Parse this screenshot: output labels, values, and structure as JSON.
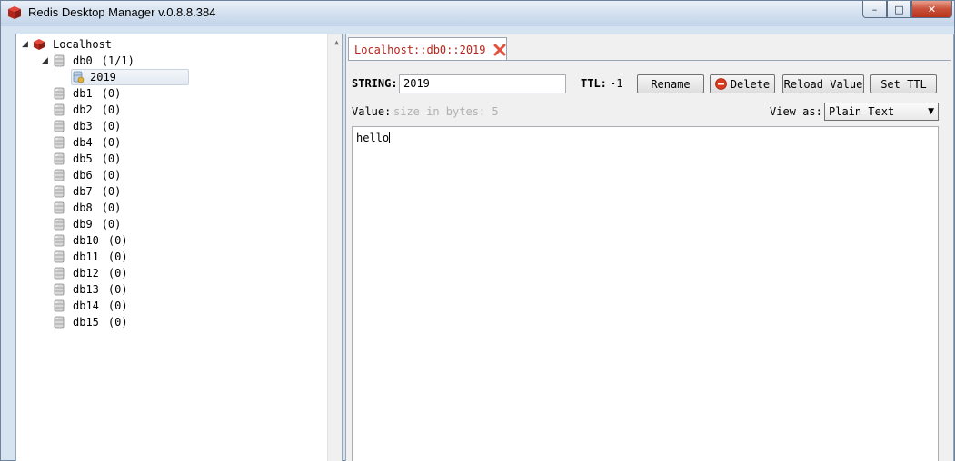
{
  "window": {
    "title": "Redis Desktop Manager v.0.8.8.384",
    "controls": {
      "minimize": "–",
      "maximize": "□",
      "close": "✕"
    }
  },
  "tree": {
    "server": {
      "label": "Localhost",
      "icon": "redis-server-icon"
    },
    "databases": [
      {
        "name": "db0",
        "count": "(1/1)",
        "expanded": true
      },
      {
        "name": "db1",
        "count": "(0)"
      },
      {
        "name": "db2",
        "count": "(0)"
      },
      {
        "name": "db3",
        "count": "(0)"
      },
      {
        "name": "db4",
        "count": "(0)"
      },
      {
        "name": "db5",
        "count": "(0)"
      },
      {
        "name": "db6",
        "count": "(0)"
      },
      {
        "name": "db7",
        "count": "(0)"
      },
      {
        "name": "db8",
        "count": "(0)"
      },
      {
        "name": "db9",
        "count": "(0)"
      },
      {
        "name": "db10",
        "count": "(0)"
      },
      {
        "name": "db11",
        "count": "(0)"
      },
      {
        "name": "db12",
        "count": "(0)"
      },
      {
        "name": "db13",
        "count": "(0)"
      },
      {
        "name": "db14",
        "count": "(0)"
      },
      {
        "name": "db15",
        "count": "(0)"
      }
    ],
    "selected_key": "2019"
  },
  "tab": {
    "label": "Localhost::db0::2019"
  },
  "key_editor": {
    "type_label": "STRING:",
    "key_name": "2019",
    "ttl_label": "TTL:",
    "ttl_value": "-1",
    "buttons": {
      "rename": "Rename",
      "delete": "Delete",
      "reload": "Reload Value",
      "set_ttl": "Set TTL"
    },
    "value_label": "Value:",
    "size_hint": "size in bytes: 5",
    "view_as_label": "View as:",
    "view_as_selected": "Plain Text",
    "value": "hello"
  },
  "colors": {
    "tab_text": "#b5251a",
    "redis_red": "#c9302c",
    "delete_red": "#d9381e"
  }
}
